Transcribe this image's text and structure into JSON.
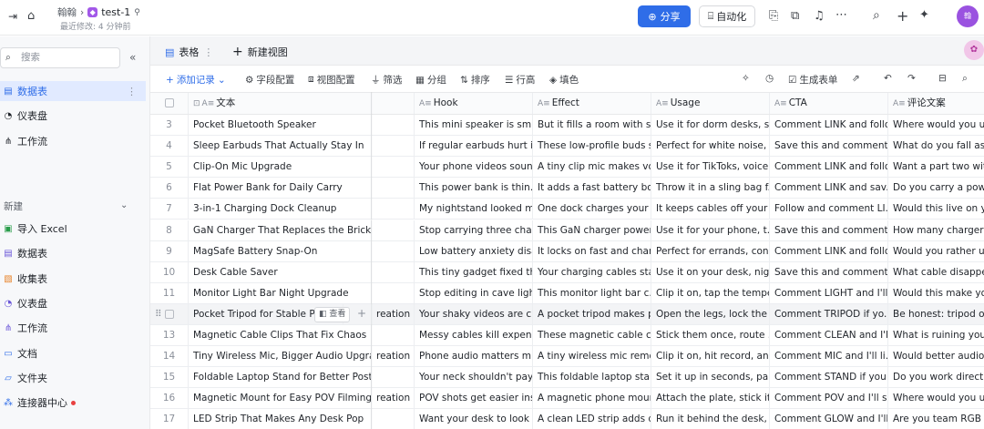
{
  "topbar": {
    "breadcrumb_parent": "翰翰",
    "doc_title": "test-1",
    "last_modified": "最近修改: 4 分钟前",
    "share_label": "分享",
    "automation_label": "自动化",
    "avatar_text": "翰"
  },
  "sidebar": {
    "search_placeholder": "搜索",
    "items": [
      {
        "label": "数据表",
        "icon": "grid-icon"
      },
      {
        "label": "仪表盘",
        "icon": "dashboard-icon"
      },
      {
        "label": "工作流",
        "icon": "workflow-icon"
      }
    ],
    "new_section_title": "新建",
    "new_items": [
      {
        "label": "导入 Excel",
        "icon": "excel-icon"
      },
      {
        "label": "数据表",
        "icon": "grid-icon"
      },
      {
        "label": "收集表",
        "icon": "form-icon"
      },
      {
        "label": "仪表盘",
        "icon": "dashboard-icon"
      },
      {
        "label": "工作流",
        "icon": "workflow-icon"
      },
      {
        "label": "文档",
        "icon": "doc-icon"
      },
      {
        "label": "文件夹",
        "icon": "folder-icon"
      },
      {
        "label": "连接器中心",
        "icon": "connector-icon"
      }
    ]
  },
  "view_tabs": {
    "active": "表格",
    "new_view": "新建视图"
  },
  "toolbar": {
    "add_record": "添加记录",
    "field_config": "字段配置",
    "view_config": "视图配置",
    "filter": "筛选",
    "group": "分组",
    "sort": "排序",
    "row_height": "行高",
    "fill": "填色",
    "generate_form": "生成表单"
  },
  "table": {
    "columns": [
      "文本",
      "Hook",
      "Effect",
      "Usage",
      "CTA",
      "评论文案"
    ],
    "view_label": "查看",
    "rows": [
      {
        "n": "3",
        "text": "Pocket Bluetooth Speaker",
        "overflow": "",
        "hook": "This mini speaker is sm...",
        "effect": "But it fills a room with s...",
        "usage": "Use it for dorm desks, s...",
        "cta": "Comment LINK and follo...",
        "comment": "Where would you use"
      },
      {
        "n": "4",
        "text": "Sleep Earbuds That Actually Stay In",
        "overflow": "",
        "hook": "If regular earbuds hurt i...",
        "effect": "These low-profile buds s...",
        "usage": "Perfect for white noise, ...",
        "cta": "Save this and comment ...",
        "comment": "What do you fall aslee"
      },
      {
        "n": "5",
        "text": "Clip-On Mic Upgrade",
        "overflow": "",
        "hook": "Your phone videos soun...",
        "effect": "A tiny clip mic makes vo...",
        "usage": "Use it for TikToks, voice...",
        "cta": "Comment LINK and follo...",
        "comment": "Want a part two with b"
      },
      {
        "n": "6",
        "text": "Flat Power Bank for Daily Carry",
        "overflow": "",
        "hook": "This power bank is thin...",
        "effect": "It adds a fast battery bo...",
        "usage": "Throw it in a sling bag f...",
        "cta": "Comment LINK and sav...",
        "comment": "Do you carry a power"
      },
      {
        "n": "7",
        "text": "3-in-1 Charging Dock Cleanup",
        "overflow": "",
        "hook": "My nightstand looked m...",
        "effect": "One dock charges your ...",
        "usage": "It keeps cables off your ...",
        "cta": "Follow and comment LI...",
        "comment": "Would this live on you"
      },
      {
        "n": "8",
        "text": "GaN Charger That Replaces the Brick Pile",
        "overflow": "",
        "hook": "Stop carrying three char...",
        "effect": "This GaN charger power...",
        "usage": "Use it for your phone, t...",
        "cta": "Save this and comment ...",
        "comment": "How many chargers ar"
      },
      {
        "n": "9",
        "text": "MagSafe Battery Snap-On",
        "overflow": "",
        "hook": "Low battery anxiety disa...",
        "effect": "It locks on fast and char...",
        "usage": "Perfect for errands, con...",
        "cta": "Comment LINK and follo...",
        "comment": "Would you rather use"
      },
      {
        "n": "10",
        "text": "Desk Cable Saver",
        "overflow": "",
        "hook": "This tiny gadget fixed th...",
        "effect": "Your charging cables sta...",
        "usage": "Use it on your desk, nig...",
        "cta": "Save this and comment ...",
        "comment": "What cable disappears"
      },
      {
        "n": "11",
        "text": "Monitor Light Bar Night Upgrade",
        "overflow": "",
        "hook": "Stop editing in cave ligh...",
        "effect": "This monitor light bar c...",
        "usage": "Clip it on, tap the tempe...",
        "cta": "Comment LIGHT and I'll...",
        "comment": "Would this make your"
      },
      {
        "n": "12",
        "text": "Pocket Tripod for Stable Phone",
        "overflow": "reation",
        "hook": "Your shaky videos are c...",
        "effect": "A pocket tripod makes p...",
        "usage": "Open the legs, lock the ...",
        "cta": "Comment TRIPOD if yo...",
        "comment": "Be honest: tripod or h"
      },
      {
        "n": "13",
        "text": "Magnetic Cable Clips That Fix Chaos",
        "overflow": "",
        "hook": "Messy cables kill expens...",
        "effect": "These magnetic cable cl...",
        "usage": "Stick them once, route ...",
        "cta": "Comment CLEAN and I'll...",
        "comment": "What is ruining your d"
      },
      {
        "n": "14",
        "text": "Tiny Wireless Mic, Bigger Audio Upgrade",
        "overflow": "reation",
        "hook": "Phone audio matters m...",
        "effect": "A tiny wireless mic remo...",
        "usage": "Clip it on, hit record, an...",
        "cta": "Comment MIC and I'll li...",
        "comment": "Would better audio he"
      },
      {
        "n": "15",
        "text": "Foldable Laptop Stand for Better Posture",
        "overflow": "",
        "hook": "Your neck shouldn't pay...",
        "effect": "This foldable laptop sta...",
        "usage": "Set it up in seconds, pai...",
        "cta": "Comment STAND if you ...",
        "comment": "Do you work directly o"
      },
      {
        "n": "16",
        "text": "Magnetic Mount for Easy POV Filming",
        "overflow": "reation",
        "hook": "POV shots get easier ins...",
        "effect": "A magnetic phone moun...",
        "usage": "Attach the plate, stick it ...",
        "cta": "Comment POV and I'll s...",
        "comment": "Where would you use"
      },
      {
        "n": "17",
        "text": "LED Strip That Makes Any Desk Pop",
        "overflow": "",
        "hook": "Want your desk to look ...",
        "effect": "A clean LED strip adds d...",
        "usage": "Run it behind the desk, ...",
        "cta": "Comment GLOW and I'll...",
        "comment": "Are you team RGB or"
      }
    ]
  }
}
